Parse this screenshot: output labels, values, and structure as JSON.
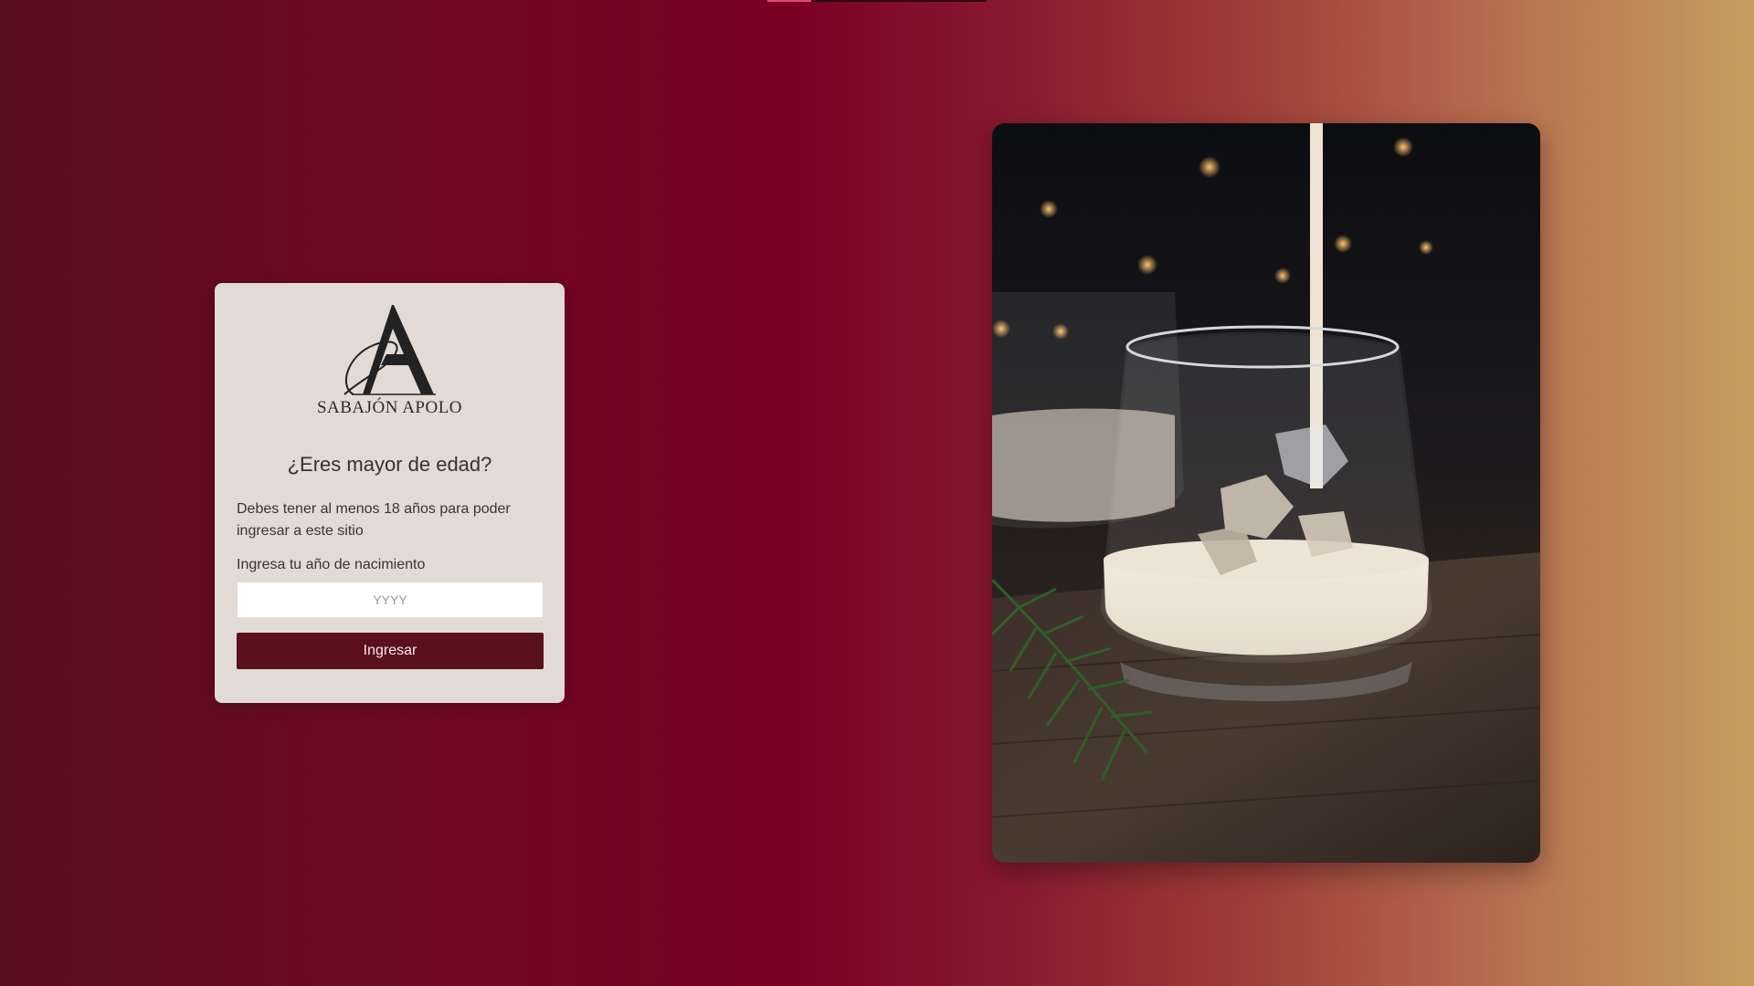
{
  "brand": {
    "logo_letter": "A",
    "name": "SABAJÓN APOLO"
  },
  "age_gate": {
    "title": "¿Eres mayor de edad?",
    "description": "Debes tener al menos 18 años para poder ingresar a este sitio",
    "year_label": "Ingresa tu año de nacimiento",
    "year_placeholder": "YYYY",
    "year_value": "",
    "submit_label": "Ingresar"
  },
  "photo": {
    "icon": "sabajon-glass-photo"
  },
  "colors": {
    "card_bg": "#e2dad5",
    "button_bg": "#5a111c",
    "accent_pink": "#e0457a"
  }
}
